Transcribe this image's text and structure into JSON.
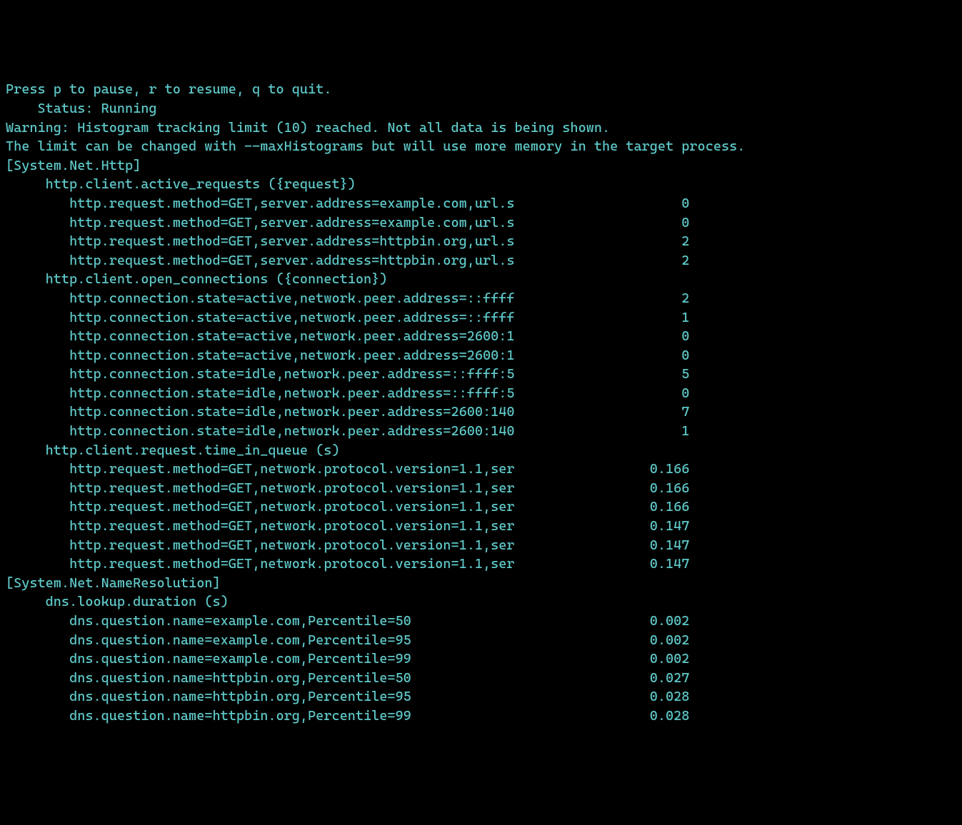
{
  "header": {
    "controls": "Press p to pause, r to resume, q to quit.",
    "status_label": "    Status:",
    "status_value": " Running",
    "warning1": "Warning: Histogram tracking limit (10) reached. Not all data is being shown.",
    "warning2": "The limit can be changed with --maxHistograms but will use more memory in the target process."
  },
  "groups": [
    {
      "name": "[System.Net.Http]",
      "metrics": [
        {
          "name": "http.client.active_requests ({request})",
          "rows": [
            {
              "label": "http.request.method=GET,server.address=example.com,url.s",
              "value": "0"
            },
            {
              "label": "http.request.method=GET,server.address=example.com,url.s",
              "value": "0"
            },
            {
              "label": "http.request.method=GET,server.address=httpbin.org,url.s",
              "value": "2"
            },
            {
              "label": "http.request.method=GET,server.address=httpbin.org,url.s",
              "value": "2"
            }
          ]
        },
        {
          "name": "http.client.open_connections ({connection})",
          "rows": [
            {
              "label": "http.connection.state=active,network.peer.address=::ffff",
              "value": "2"
            },
            {
              "label": "http.connection.state=active,network.peer.address=::ffff",
              "value": "1"
            },
            {
              "label": "http.connection.state=active,network.peer.address=2600:1",
              "value": "0"
            },
            {
              "label": "http.connection.state=active,network.peer.address=2600:1",
              "value": "0"
            },
            {
              "label": "http.connection.state=idle,network.peer.address=::ffff:5",
              "value": "5"
            },
            {
              "label": "http.connection.state=idle,network.peer.address=::ffff:5",
              "value": "0"
            },
            {
              "label": "http.connection.state=idle,network.peer.address=2600:140",
              "value": "7"
            },
            {
              "label": "http.connection.state=idle,network.peer.address=2600:140",
              "value": "1"
            }
          ]
        },
        {
          "name": "http.client.request.time_in_queue (s)",
          "rows": [
            {
              "label": "http.request.method=GET,network.protocol.version=1.1,ser",
              "value": "0.166"
            },
            {
              "label": "http.request.method=GET,network.protocol.version=1.1,ser",
              "value": "0.166"
            },
            {
              "label": "http.request.method=GET,network.protocol.version=1.1,ser",
              "value": "0.166"
            },
            {
              "label": "http.request.method=GET,network.protocol.version=1.1,ser",
              "value": "0.147"
            },
            {
              "label": "http.request.method=GET,network.protocol.version=1.1,ser",
              "value": "0.147"
            },
            {
              "label": "http.request.method=GET,network.protocol.version=1.1,ser",
              "value": "0.147"
            }
          ]
        }
      ]
    },
    {
      "name": "[System.Net.NameResolution]",
      "metrics": [
        {
          "name": "dns.lookup.duration (s)",
          "rows": [
            {
              "label": "dns.question.name=example.com,Percentile=50",
              "value": "0.002"
            },
            {
              "label": "dns.question.name=example.com,Percentile=95",
              "value": "0.002"
            },
            {
              "label": "dns.question.name=example.com,Percentile=99",
              "value": "0.002"
            },
            {
              "label": "dns.question.name=httpbin.org,Percentile=50",
              "value": "0.027"
            },
            {
              "label": "dns.question.name=httpbin.org,Percentile=95",
              "value": "0.028"
            },
            {
              "label": "dns.question.name=httpbin.org,Percentile=99",
              "value": "0.028"
            }
          ]
        }
      ]
    }
  ]
}
